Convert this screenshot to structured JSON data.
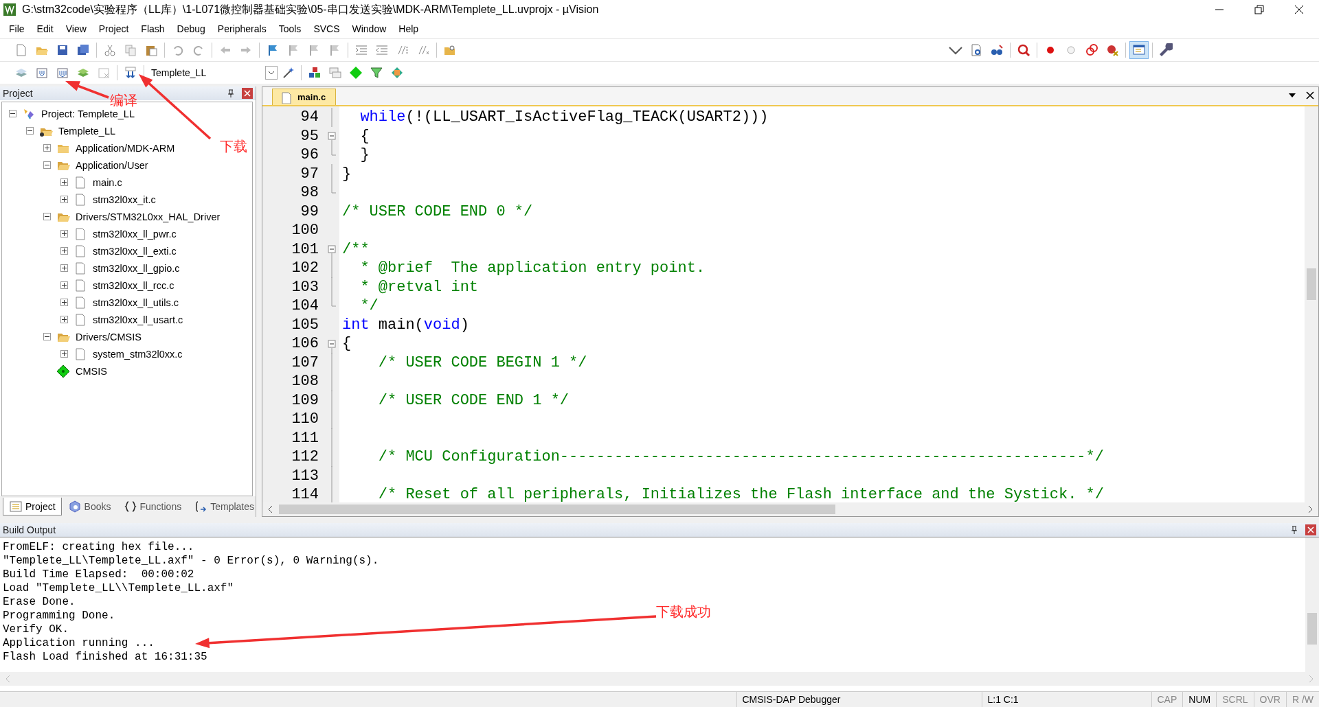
{
  "window": {
    "title": "G:\\stm32code\\实验程序（LL库）\\1-L071微控制器基础实验\\05-串口发送实验\\MDK-ARM\\Templete_LL.uvprojx - µVision"
  },
  "menu": [
    "File",
    "Edit",
    "View",
    "Project",
    "Flash",
    "Debug",
    "Peripherals",
    "Tools",
    "SVCS",
    "Window",
    "Help"
  ],
  "target": {
    "value": "Templete_LL"
  },
  "project_panel": {
    "title": "Project",
    "tree": [
      {
        "label": "Project: Templete_LL",
        "kind": "project",
        "expanded": true,
        "children": [
          {
            "label": "Templete_LL",
            "kind": "target",
            "expanded": true,
            "children": [
              {
                "label": "Application/MDK-ARM",
                "kind": "group",
                "expanded": false
              },
              {
                "label": "Application/User",
                "kind": "group",
                "expanded": true,
                "children": [
                  {
                    "label": "main.c",
                    "kind": "file",
                    "expanded": false
                  },
                  {
                    "label": "stm32l0xx_it.c",
                    "kind": "file",
                    "expanded": false
                  }
                ]
              },
              {
                "label": "Drivers/STM32L0xx_HAL_Driver",
                "kind": "group",
                "expanded": true,
                "children": [
                  {
                    "label": "stm32l0xx_ll_pwr.c",
                    "kind": "file",
                    "expanded": false
                  },
                  {
                    "label": "stm32l0xx_ll_exti.c",
                    "kind": "file",
                    "expanded": false
                  },
                  {
                    "label": "stm32l0xx_ll_gpio.c",
                    "kind": "file",
                    "expanded": false
                  },
                  {
                    "label": "stm32l0xx_ll_rcc.c",
                    "kind": "file",
                    "expanded": false
                  },
                  {
                    "label": "stm32l0xx_ll_utils.c",
                    "kind": "file",
                    "expanded": false
                  },
                  {
                    "label": "stm32l0xx_ll_usart.c",
                    "kind": "file",
                    "expanded": false
                  }
                ]
              },
              {
                "label": "Drivers/CMSIS",
                "kind": "group",
                "expanded": true,
                "children": [
                  {
                    "label": "system_stm32l0xx.c",
                    "kind": "file",
                    "expanded": false
                  }
                ]
              },
              {
                "label": "CMSIS",
                "kind": "component"
              }
            ]
          }
        ]
      }
    ],
    "tabs": [
      {
        "label": "Project",
        "kind": "project",
        "selected": true
      },
      {
        "label": "Books",
        "kind": "books",
        "selected": false
      },
      {
        "label": "Functions",
        "kind": "functions",
        "selected": false
      },
      {
        "label": "Templates",
        "kind": "templates",
        "selected": false
      }
    ]
  },
  "editor": {
    "tabs": [
      {
        "label": "main.c",
        "selected": true
      }
    ],
    "lines": [
      {
        "number": "94",
        "kind": "inner",
        "segments": [
          {
            "kind": "keyword",
            "text": "  while"
          },
          {
            "kind": "plain",
            "text": "(!(LL_USART_IsActiveFlag_TEACK(USART2)))"
          }
        ]
      },
      {
        "number": "95",
        "kind": "start",
        "segments": [
          {
            "kind": "plain",
            "text": "  {"
          }
        ]
      },
      {
        "number": "96",
        "kind": "end",
        "segments": [
          {
            "kind": "plain",
            "text": "  }"
          }
        ]
      },
      {
        "number": "97",
        "kind": "inner",
        "segments": [
          {
            "kind": "plain",
            "text": "}"
          }
        ]
      },
      {
        "number": "98",
        "kind": "end"
      },
      {
        "number": "99",
        "kind": "plain",
        "segments": [
          {
            "kind": "comment",
            "text": "/* USER CODE END 0 */"
          }
        ]
      },
      {
        "number": "100",
        "kind": "plain"
      },
      {
        "number": "101",
        "kind": "start",
        "segments": [
          {
            "kind": "comment",
            "text": "/**"
          }
        ]
      },
      {
        "number": "102",
        "kind": "inner",
        "segments": [
          {
            "kind": "comment",
            "text": "  * @brief  The application entry point."
          }
        ]
      },
      {
        "number": "103",
        "kind": "inner",
        "segments": [
          {
            "kind": "comment",
            "text": "  * @retval int"
          }
        ]
      },
      {
        "number": "104",
        "kind": "end",
        "segments": [
          {
            "kind": "comment",
            "text": "  */"
          }
        ]
      },
      {
        "number": "105",
        "kind": "plain",
        "segments": [
          {
            "kind": "keyword",
            "text": "int"
          },
          {
            "kind": "plain",
            "text": " main("
          },
          {
            "kind": "keyword",
            "text": "void"
          },
          {
            "kind": "plain",
            "text": ")"
          }
        ]
      },
      {
        "number": "106",
        "kind": "start",
        "segments": [
          {
            "kind": "plain",
            "text": "{"
          }
        ]
      },
      {
        "number": "107",
        "kind": "inner",
        "segments": [
          {
            "kind": "comment",
            "text": "    /* USER CODE BEGIN 1 */"
          }
        ]
      },
      {
        "number": "108",
        "kind": "inner"
      },
      {
        "number": "109",
        "kind": "inner",
        "segments": [
          {
            "kind": "comment",
            "text": "    /* USER CODE END 1 */"
          }
        ]
      },
      {
        "number": "110",
        "kind": "inner"
      },
      {
        "number": "111",
        "kind": "inner"
      },
      {
        "number": "112",
        "kind": "inner",
        "segments": [
          {
            "kind": "comment",
            "text": "    /* MCU Configuration----------------------------------------------------------*/"
          }
        ]
      },
      {
        "number": "113",
        "kind": "inner"
      },
      {
        "number": "114",
        "kind": "inner",
        "segments": [
          {
            "kind": "comment",
            "text": "    /* Reset of all peripherals, Initializes the Flash interface and the Systick. */"
          }
        ]
      }
    ]
  },
  "build_output": {
    "title": "Build Output",
    "lines": [
      "FromELF: creating hex file...",
      "\"Templete_LL\\Templete_LL.axf\" - 0 Error(s), 0 Warning(s).",
      "Build Time Elapsed:  00:00:02",
      "Load \"Templete_LL\\\\Templete_LL.axf\"",
      "Erase Done.",
      "Programming Done.",
      "Verify OK.",
      "Application running ...",
      "Flash Load finished at 16:31:35"
    ]
  },
  "status_bar": {
    "debugger": "CMSIS-DAP Debugger",
    "position": "L:1 C:1",
    "indicators": [
      {
        "label": "CAP",
        "on": false
      },
      {
        "label": "NUM",
        "on": true
      },
      {
        "label": "SCRL",
        "on": false
      },
      {
        "label": "OVR",
        "on": false
      },
      {
        "label": "R /W",
        "on": false
      }
    ]
  },
  "annotations": [
    {
      "text": "编译"
    },
    {
      "text": "下载"
    },
    {
      "text": "下载成功"
    }
  ]
}
